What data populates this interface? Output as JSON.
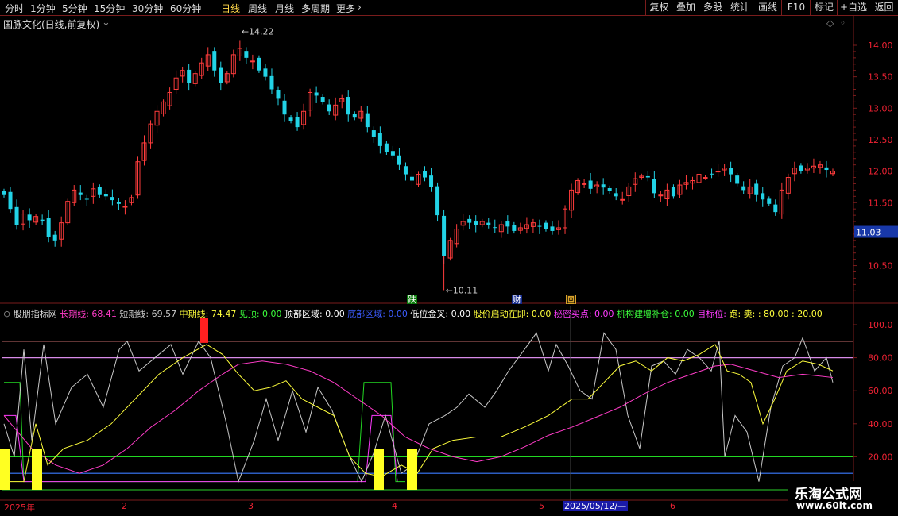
{
  "toolbar": {
    "periods": [
      "分时",
      "1分钟",
      "5分钟",
      "15分钟",
      "30分钟",
      "60分钟",
      "日线",
      "周线",
      "月线",
      "多周期",
      "更多"
    ],
    "active_period": "日线",
    "right_buttons": [
      "复权",
      "叠加",
      "多股",
      "统计",
      "画线",
      "F10",
      "标记",
      "+自选",
      "返回"
    ]
  },
  "main_chart": {
    "title": "国脉文化(日线,前复权)",
    "high_label": "14.22",
    "low_label": "10.11",
    "current_price": "11.03",
    "price_ticks": [
      "14.00",
      "13.50",
      "13.00",
      "12.50",
      "12.00",
      "11.50",
      "11.00",
      "10.50"
    ],
    "markers": [
      "跌",
      "财",
      "回"
    ],
    "colors": {
      "up": "#ff3c3c",
      "down": "#22d3e6",
      "frame": "#7a1c1c"
    }
  },
  "indicator": {
    "name": "股朋指标网",
    "legend": [
      {
        "label": "长期线: ",
        "value": "68.41",
        "color": "#ff3cc8"
      },
      {
        "label": "短期线: ",
        "value": "69.57",
        "color": "#c8c8c8"
      },
      {
        "label": "中期线: ",
        "value": "74.47",
        "color": "#ffff3c"
      },
      {
        "label": "见顶: ",
        "value": "0.00",
        "color": "#3cff3c"
      },
      {
        "label": "顶部区域: ",
        "value": "0.00",
        "color": "#ffffff"
      },
      {
        "label": "底部区域: ",
        "value": "0.00",
        "color": "#3c5cff"
      },
      {
        "label": "低位金叉: ",
        "value": "0.00",
        "color": "#ffffff"
      },
      {
        "label": "股价启动在即: ",
        "value": "0.00",
        "color": "#ffff3c"
      },
      {
        "label": "秘密买点: ",
        "value": "0.00",
        "color": "#ff3cff"
      },
      {
        "label": "机构建增补仓: ",
        "value": "0.00",
        "color": "#3cff3c"
      },
      {
        "label": "目标位: ",
        "value": "",
        "color": "#ff3cff"
      },
      {
        "label": "跑: ",
        "value": "",
        "color": "#ffff3c"
      },
      {
        "label": "卖: ",
        "value": ": 80.00",
        "color": "#ffff3c"
      },
      {
        "label": "",
        "value": ": 20.00",
        "color": "#ffff3c"
      }
    ],
    "y_ticks": [
      "100.0",
      "80.00",
      "60.00",
      "40.00",
      "20.00"
    ]
  },
  "x_axis": {
    "labels": [
      "2025年",
      "2",
      "3",
      "4",
      "5",
      "6"
    ],
    "cursor_date": "2025/05/12/—"
  },
  "watermark": {
    "title": "乐淘公式网",
    "url": "www.60lt.com"
  }
}
